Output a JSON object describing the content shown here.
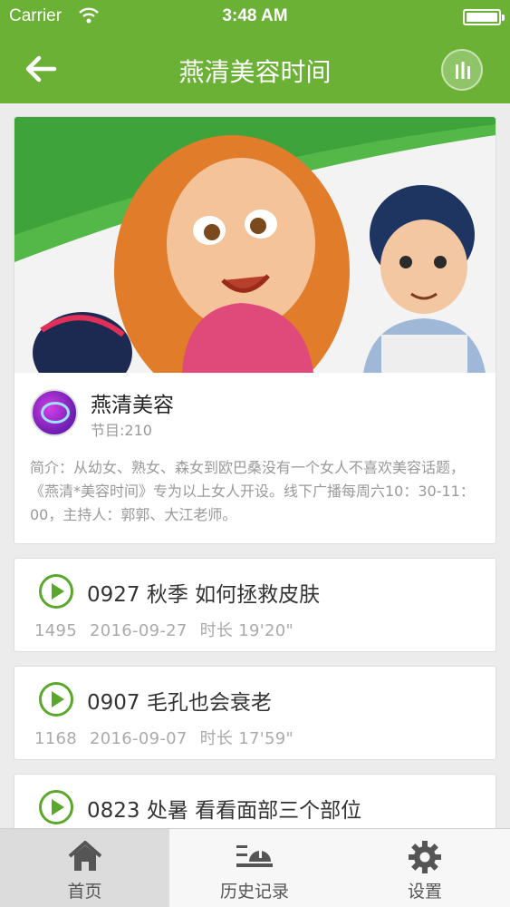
{
  "status_bar": {
    "carrier": "Carrier",
    "time": "3:48 AM"
  },
  "nav": {
    "title": "燕清美容时间",
    "back_icon": "arrow-left-icon",
    "menu_icon": "bars-icon"
  },
  "program": {
    "name": "燕清美容",
    "count": "节目:210",
    "intro": "简介：从幼女、熟女、森女到欧巴桑没有一个女人不喜欢美容话题，《燕清*美容时间》专为以上女人开设。线下广播每周六10：30-11：00，主持人：郭郭、大江老师。"
  },
  "episodes": [
    {
      "title": "0927 秋季 如何拯救皮肤",
      "plays": "1495",
      "date": "2016-09-27",
      "duration": "时长 19'20\""
    },
    {
      "title": "0907 毛孔也会衰老",
      "plays": "1168",
      "date": "2016-09-07",
      "duration": "时长 17'59\""
    },
    {
      "title": "0823 处暑 看看面部三个部位",
      "plays": "",
      "date": "",
      "duration": ""
    }
  ],
  "tabs": [
    {
      "label": "首页",
      "icon": "home-icon",
      "active": true
    },
    {
      "label": "历史记录",
      "icon": "history-icon",
      "active": false
    },
    {
      "label": "设置",
      "icon": "gear-icon",
      "active": false
    }
  ],
  "colors": {
    "brand_green": "#6bb136",
    "play_green": "#5aa82b"
  }
}
